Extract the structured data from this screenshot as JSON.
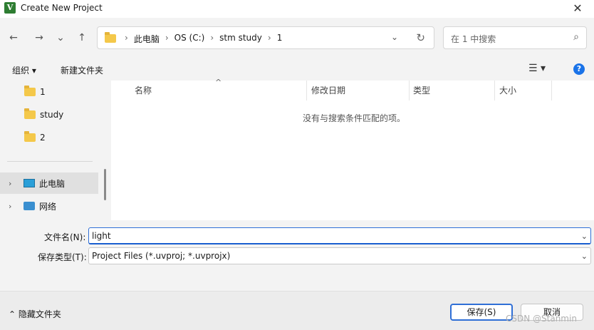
{
  "window": {
    "title": "Create New Project",
    "app_icon_glyph": "V",
    "close_glyph": "✕"
  },
  "nav": {
    "back": "←",
    "forward": "→",
    "recent": "⌄",
    "up": "↑",
    "breadcrumb": [
      "此电脑",
      "OS (C:)",
      "stm study",
      "1"
    ],
    "sep": "›",
    "dropdown_glyph": "⌄",
    "refresh_glyph": "↻",
    "search_placeholder": "在 1 中搜索",
    "search_glyph": "⌕"
  },
  "toolbar": {
    "organize": "组织 ▾",
    "new_folder": "新建文件夹",
    "view_glyph": "☰ ▾",
    "help_glyph": "?"
  },
  "sidebar": {
    "items": [
      {
        "label": "1",
        "icon": "folder-icon"
      },
      {
        "label": "study",
        "icon": "folder-icon"
      },
      {
        "label": "2",
        "icon": "folder-icon"
      },
      {
        "label": "此电脑",
        "icon": "computer-icon",
        "selected": true
      },
      {
        "label": "网络",
        "icon": "network-icon"
      }
    ],
    "chevron": "›"
  },
  "file_list": {
    "columns": [
      "名称",
      "修改日期",
      "类型",
      "大小"
    ],
    "sort_caret": "^",
    "empty_message": "没有与搜索条件匹配的项。"
  },
  "form": {
    "filename_label": "文件名(N):",
    "filename_value": "light",
    "filetype_label": "保存类型(T):",
    "filetype_value": "Project Files (*.uvproj; *.uvprojx)",
    "dropdown_glyph": "⌄"
  },
  "footer": {
    "hide_folders": "⌃ 隐藏文件夹",
    "save": "保存(S)",
    "cancel": "取消"
  },
  "watermark": "CSDN @Stanmin",
  "colors": {
    "accent": "#2f6fd6",
    "folder": "#f4c84a",
    "help": "#1a73e8"
  }
}
